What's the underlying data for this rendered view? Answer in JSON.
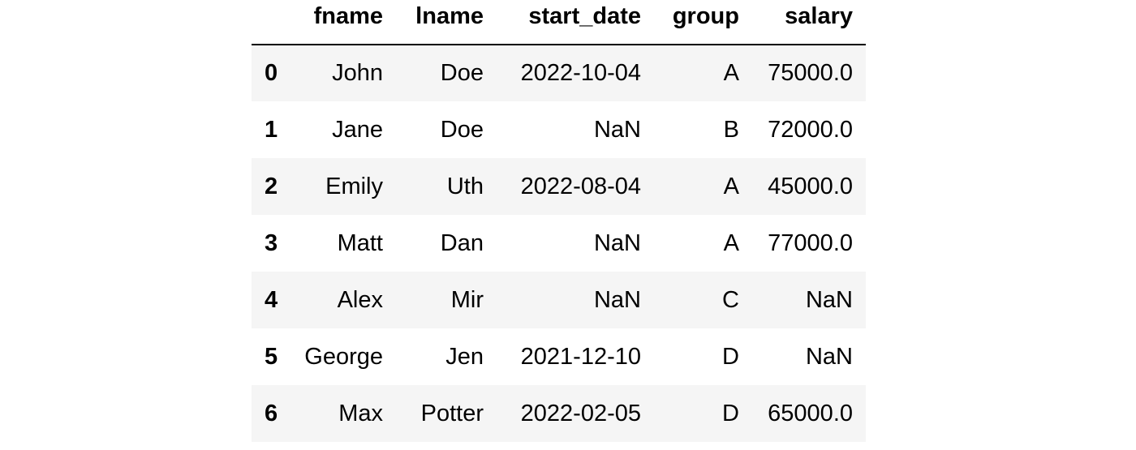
{
  "table": {
    "columns": [
      "",
      "fname",
      "lname",
      "start_date",
      "group",
      "salary"
    ],
    "rows": [
      {
        "index": "0",
        "fname": "John",
        "lname": "Doe",
        "start_date": "2022-10-04",
        "group": "A",
        "salary": "75000.0"
      },
      {
        "index": "1",
        "fname": "Jane",
        "lname": "Doe",
        "start_date": "NaN",
        "group": "B",
        "salary": "72000.0"
      },
      {
        "index": "2",
        "fname": "Emily",
        "lname": "Uth",
        "start_date": "2022-08-04",
        "group": "A",
        "salary": "45000.0"
      },
      {
        "index": "3",
        "fname": "Matt",
        "lname": "Dan",
        "start_date": "NaN",
        "group": "A",
        "salary": "77000.0"
      },
      {
        "index": "4",
        "fname": "Alex",
        "lname": "Mir",
        "start_date": "NaN",
        "group": "C",
        "salary": "NaN"
      },
      {
        "index": "5",
        "fname": "George",
        "lname": "Jen",
        "start_date": "2021-12-10",
        "group": "D",
        "salary": "NaN"
      },
      {
        "index": "6",
        "fname": "Max",
        "lname": "Potter",
        "start_date": "2022-02-05",
        "group": "D",
        "salary": "65000.0"
      }
    ]
  },
  "colors": {
    "row_stripe": "#f5f5f5",
    "row_plain": "#ffffff",
    "header_rule": "#000000",
    "text": "#000000"
  }
}
